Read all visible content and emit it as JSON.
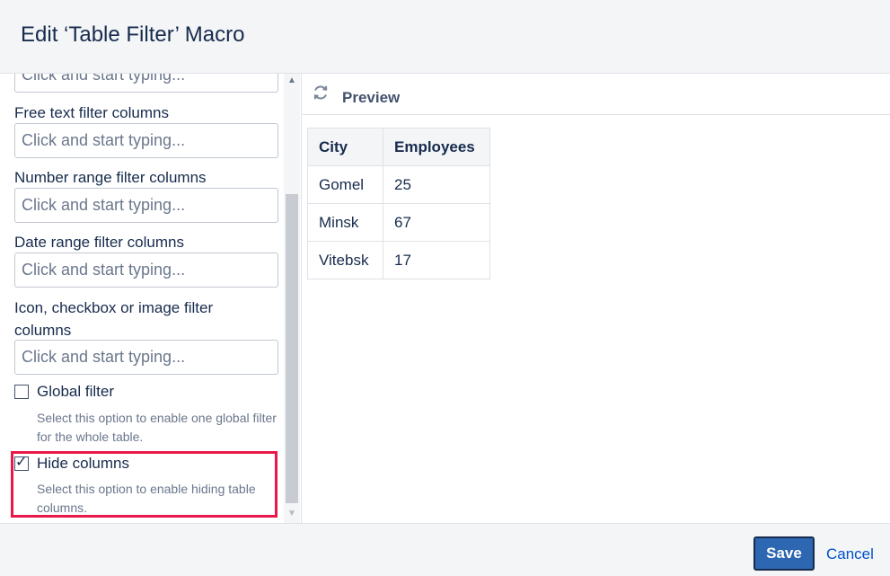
{
  "dialog": {
    "title": "Edit ‘Table Filter’ Macro"
  },
  "form": {
    "fields": [
      {
        "label": "",
        "placeholder": "Click and start typing..."
      },
      {
        "label": "Free text filter columns",
        "placeholder": "Click and start typing..."
      },
      {
        "label": "Number range filter columns",
        "placeholder": "Click and start typing..."
      },
      {
        "label": "Date range filter columns",
        "placeholder": "Click and start typing..."
      },
      {
        "label": "Icon, checkbox or image filter columns",
        "placeholder": "Click and start typing..."
      }
    ],
    "checkboxes": [
      {
        "label": "Global filter",
        "description": "Select this option to enable one global filter for the whole table.",
        "checked": false
      },
      {
        "label": "Hide columns",
        "description": "Select this option to enable hiding table columns.",
        "checked": true
      }
    ]
  },
  "preview": {
    "title": "Preview",
    "icon": "refresh-icon",
    "table": {
      "headers": [
        "City",
        "Employees"
      ],
      "rows": [
        [
          "Gomel",
          "25"
        ],
        [
          "Minsk",
          "67"
        ],
        [
          "Vitebsk",
          "17"
        ]
      ]
    }
  },
  "footer": {
    "save_label": "Save",
    "cancel_label": "Cancel"
  },
  "colors": {
    "accent": "#2d66b1",
    "highlight": "#e8194a",
    "link": "#0052cc"
  }
}
